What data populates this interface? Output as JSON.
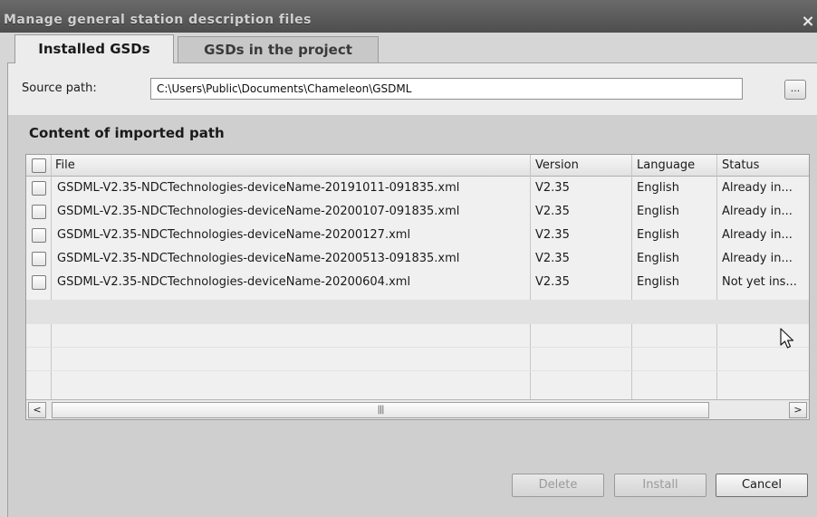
{
  "window": {
    "title": "Manage general station description files",
    "close_glyph": "×"
  },
  "tabs": [
    {
      "label": "Installed GSDs",
      "active": true
    },
    {
      "label": "GSDs in the project",
      "active": false
    }
  ],
  "source": {
    "label": "Source path:",
    "value": "C:\\Users\\Public\\Documents\\Chameleon\\GSDML",
    "browse_label": "..."
  },
  "content": {
    "title": "Content of imported path",
    "columns": {
      "file": "File",
      "version": "Version",
      "language": "Language",
      "status": "Status"
    },
    "rows": [
      {
        "file": "GSDML-V2.35-NDCTechnologies-deviceName-20191011-091835.xml",
        "version": "V2.35",
        "language": "English",
        "status": "Already in..."
      },
      {
        "file": "GSDML-V2.35-NDCTechnologies-deviceName-20200107-091835.xml",
        "version": "V2.35",
        "language": "English",
        "status": "Already in..."
      },
      {
        "file": "GSDML-V2.35-NDCTechnologies-deviceName-20200127.xml",
        "version": "V2.35",
        "language": "English",
        "status": "Already in..."
      },
      {
        "file": "GSDML-V2.35-NDCTechnologies-deviceName-20200513-091835.xml",
        "version": "V2.35",
        "language": "English",
        "status": "Already in..."
      },
      {
        "file": "GSDML-V2.35-NDCTechnologies-deviceName-20200604.xml",
        "version": "V2.35",
        "language": "English",
        "status": "Not yet ins..."
      }
    ],
    "scroll_left": "<",
    "scroll_right": ">",
    "scroll_thumb_grip": "|||"
  },
  "buttons": {
    "delete": "Delete",
    "install": "Install",
    "cancel": "Cancel"
  }
}
